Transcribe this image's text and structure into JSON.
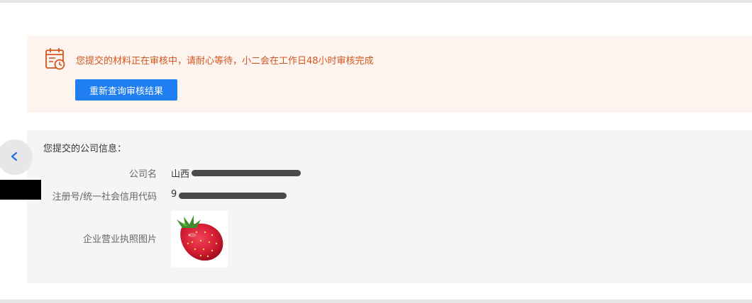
{
  "notice": {
    "icon": "calendar-clock-icon",
    "message": "您提交的材料正在审核中，请耐心等待，小二会在工作日48小时审核完成",
    "recheck_button": "重新查询审核结果",
    "accent_color": "#d4561d",
    "button_color": "#1f7ef0"
  },
  "company_info": {
    "title": "您提交的公司信息：",
    "rows": [
      {
        "label": "公司名",
        "value": "山西"
      },
      {
        "label": "注册号/统一社会信用代码",
        "value": "9"
      },
      {
        "label": "企业营业执照图片",
        "value": ""
      }
    ],
    "license_image": "strawberry-image"
  },
  "nav": {
    "back_icon": "chevron-left-icon"
  }
}
